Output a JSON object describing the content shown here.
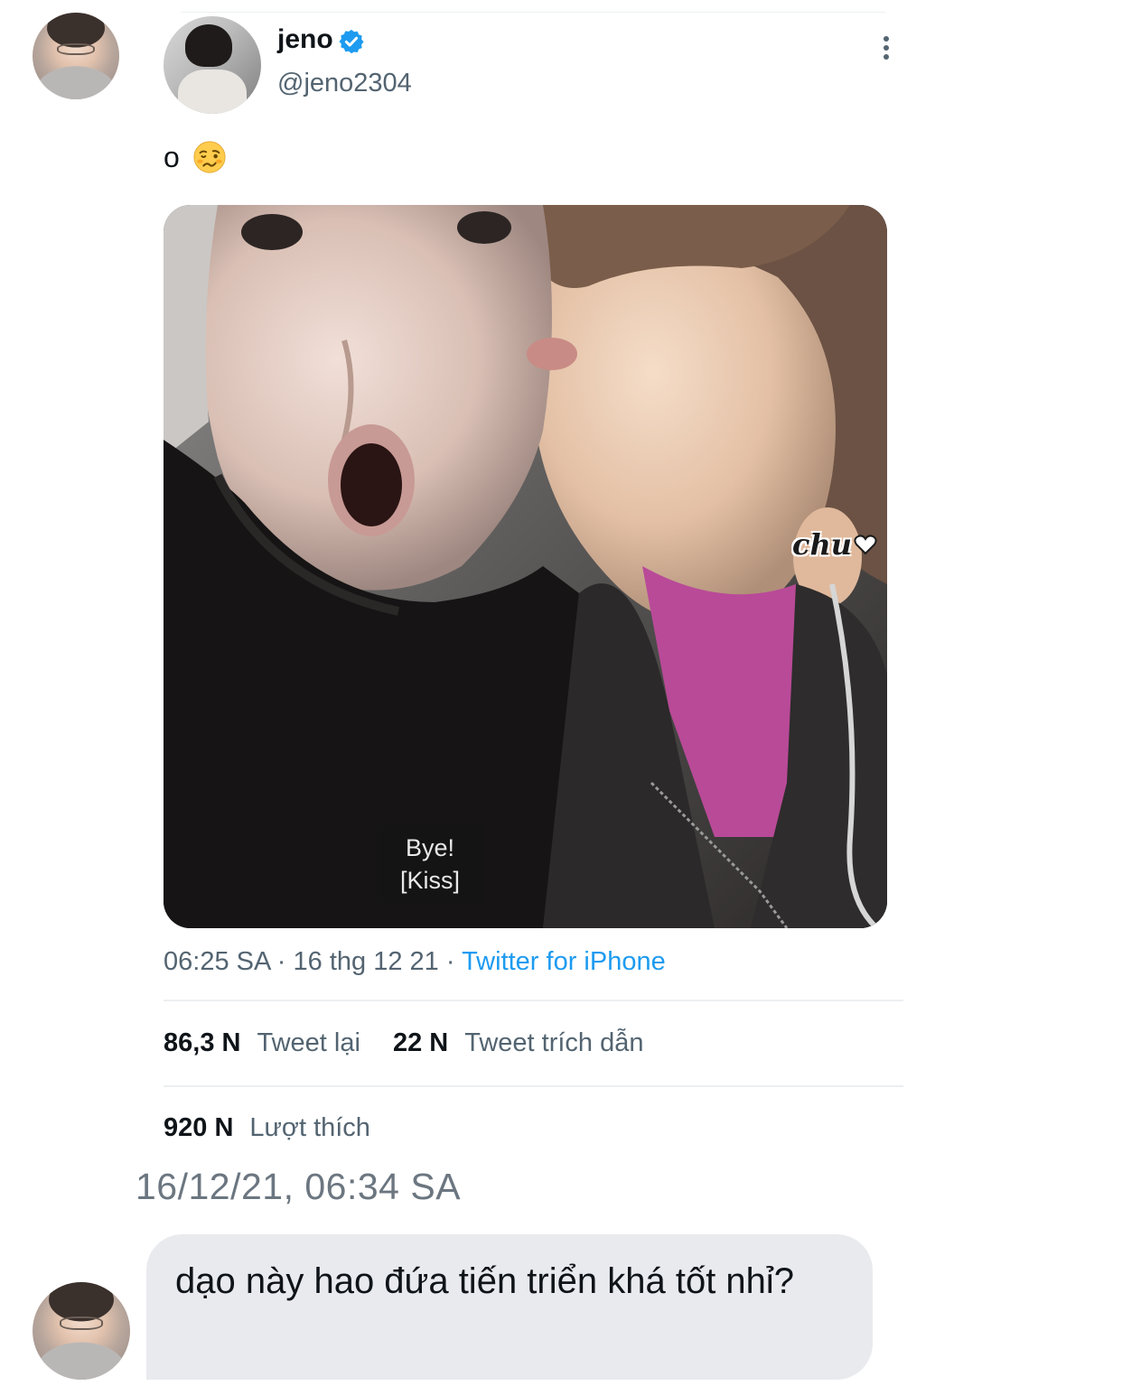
{
  "tweet": {
    "author_name": "jeno",
    "author_handle": "@jeno2304",
    "text": "o",
    "emoji": "woozy-face",
    "media": {
      "caption_line1": "Bye!",
      "caption_line2": "[Kiss]",
      "sticker_text": "chu"
    },
    "time": "06:25 SA",
    "separator": "·",
    "date": "16 thg 12 21",
    "source": "Twitter for iPhone",
    "retweets_count": "86,3 N",
    "retweets_label": "Tweet lại",
    "quotes_count": "22 N",
    "quotes_label": "Tweet trích dẫn",
    "likes_count": "920 N",
    "likes_label": "Lượt thích"
  },
  "chat": {
    "timestamp": "16/12/21, 06:34 SA",
    "message": "dạo này hao đứa tiến triển khá tốt nhỉ?"
  },
  "colors": {
    "accent": "#1d9bf0",
    "bubble": "#e9eaee",
    "muted_text": "#536471"
  }
}
